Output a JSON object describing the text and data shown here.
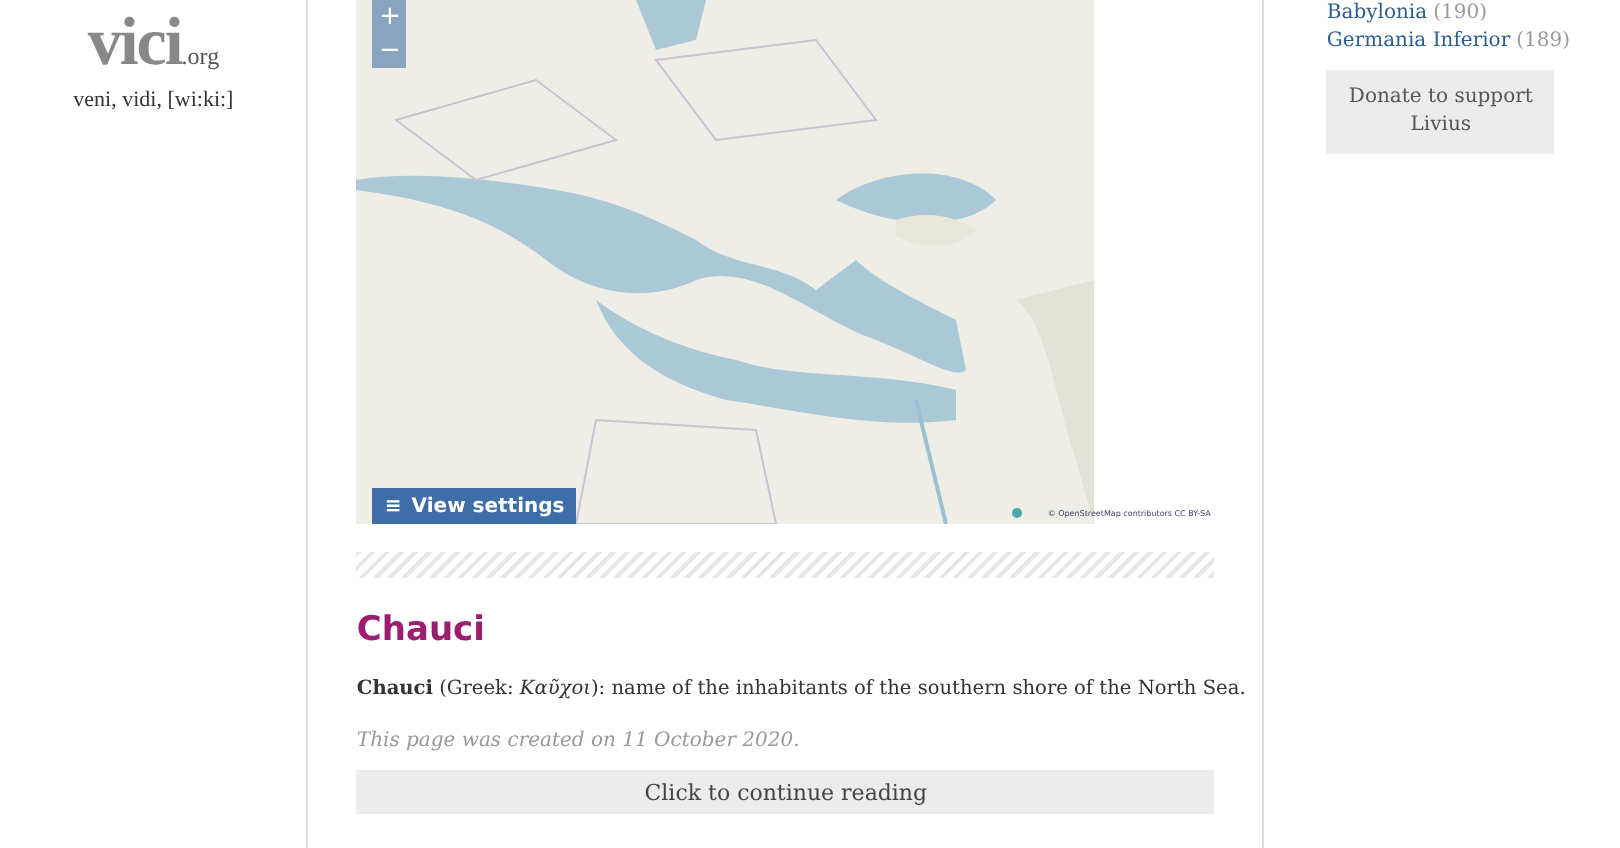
{
  "logo": {
    "name": "vici",
    "suffix": ".org",
    "tagline": "veni, vidi, [wi:ki:]"
  },
  "map": {
    "kind": "picture",
    "zoom_in": "+",
    "zoom_out": "−",
    "settings_icon": "≡",
    "settings": "View settings",
    "attribution": "© OpenStreetMap contributors CC BY-SA"
  },
  "article": {
    "title": "Chauci",
    "lead": "**Chauci** (Greek: *Καῦχοι*): name of the inhabitants of the southern shore of the North Sea.",
    "created": "This page was created on 11 October 2020.",
    "continue": "Click to continue reading"
  },
  "sidebar": {
    "links": [
      {
        "label": "Babylonia",
        "count": "(190)"
      },
      {
        "label": "Germania Inferior",
        "count": "(189)"
      }
    ],
    "donate": "Donate to support Livius"
  }
}
